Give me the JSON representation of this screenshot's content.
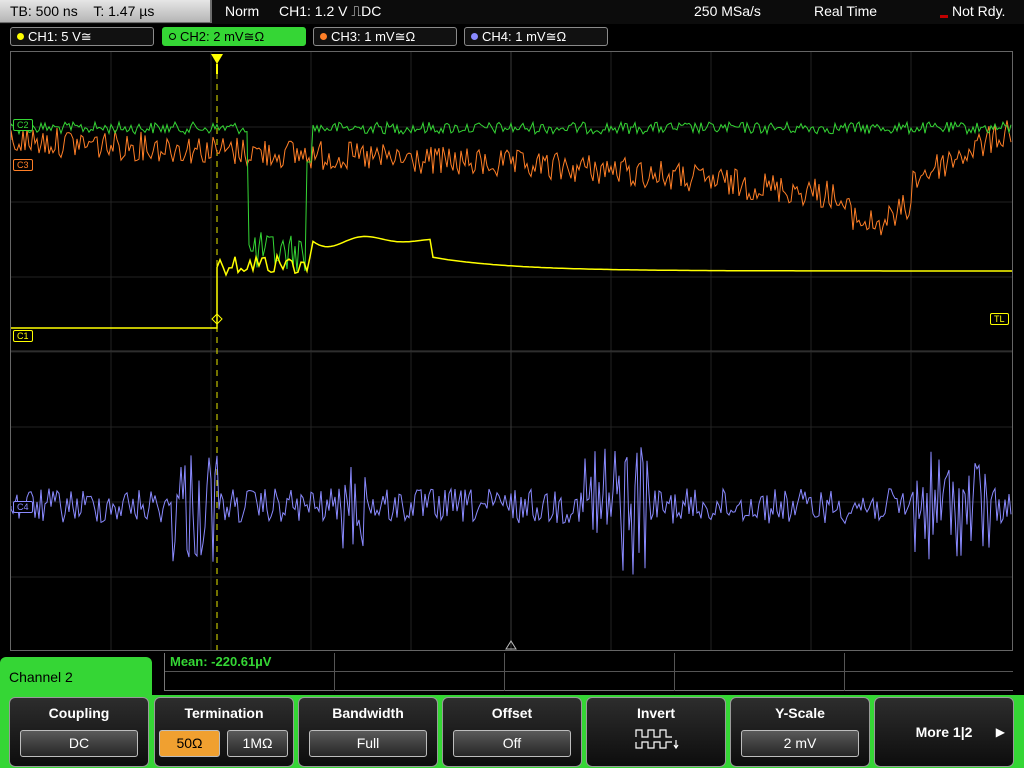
{
  "status": {
    "timebase": "TB: 500 ns",
    "trigger_time": "T: 1.47 µs",
    "trigger_mode": "Norm",
    "trigger_info": "CH1: 1.2 V ⎍DC",
    "sample_rate": "250 MSa/s",
    "acq_mode": "Real Time",
    "state": "Not Rdy."
  },
  "channels": [
    {
      "label": "CH1: 5 V≅",
      "color": "#ffff00"
    },
    {
      "label": "CH2: 2 mV≅Ω",
      "color": "#35d635"
    },
    {
      "label": "CH3: 1 mV≅Ω",
      "color": "#ff7f27"
    },
    {
      "label": "CH4: 1 mV≅Ω",
      "color": "#8a8aff"
    }
  ],
  "markers": {
    "c2": "C2",
    "c3": "C3",
    "c1": "C1",
    "c4": "C4",
    "tl": "TL"
  },
  "measurement": {
    "mean": "Mean: -220.61µV"
  },
  "menu": {
    "title": "Channel 2",
    "coupling": {
      "label": "Coupling",
      "value": "DC"
    },
    "termination": {
      "label": "Termination",
      "option_selected": "50Ω",
      "option_other": "1MΩ"
    },
    "bandwidth": {
      "label": "Bandwidth",
      "value": "Full"
    },
    "offset": {
      "label": "Offset",
      "value": "Off"
    },
    "invert": {
      "label": "Invert",
      "icon": "invert-pulse-icon"
    },
    "yscale": {
      "label": "Y-Scale",
      "value": "2 mV"
    },
    "more": {
      "label": "More 1|2"
    }
  }
}
